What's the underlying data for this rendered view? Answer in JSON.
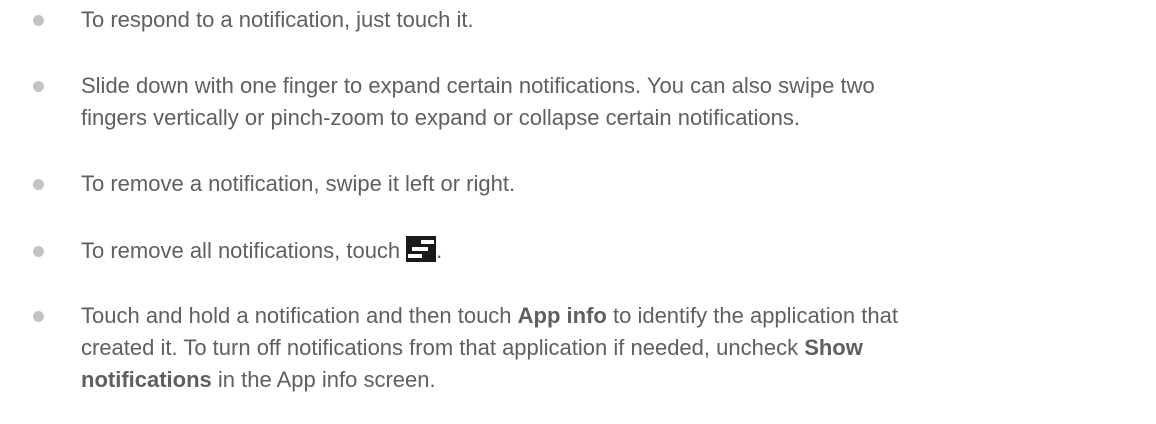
{
  "bullets": [
    {
      "text": "To respond to a notification, just touch it."
    },
    {
      "line1": "Slide down with one finger to expand certain notifications. You can also swipe two",
      "line2": "fingers vertically or pinch-zoom to expand or collapse certain notifications."
    },
    {
      "text": "To remove a notification, swipe it left or right."
    },
    {
      "text": "To remove all notifications, touch",
      "icon": "clear-all-notifications-icon",
      "after": "."
    },
    {
      "seg1": "Touch and hold a notification and then touch ",
      "bold1": "App info",
      "seg2": " to identify the application that",
      "seg3": "created it. To turn off notifications from that application if needed, uncheck ",
      "bold2a": "Show",
      "bold2b": "notifications",
      "seg4": " in the App info screen."
    }
  ],
  "colors": {
    "text": "#5f5f5f",
    "bullet": "#c4c4c4",
    "icon_bg": "#1a1a1a"
  }
}
